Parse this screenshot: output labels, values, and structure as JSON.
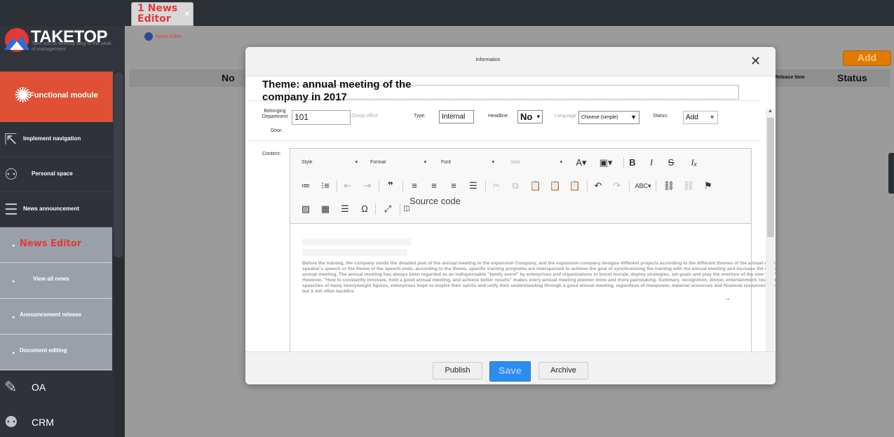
{
  "tab": {
    "title": "1 News Editor",
    "close": "×"
  },
  "logo": {
    "name": "TAKETOP",
    "tagline": "Take you to develop bing to the peak of management"
  },
  "sidebar": {
    "module": {
      "label": "Functional module"
    },
    "items": [
      {
        "label": "Implement navigation",
        "icon": "navigation-icon"
      },
      {
        "label": "Personal space",
        "icon": "person-icon"
      },
      {
        "label": "News announcement",
        "icon": "document-icon"
      }
    ],
    "subitems": [
      {
        "label": "News Editor",
        "active": true
      },
      {
        "label": "View all news"
      },
      {
        "label": "Announcement release"
      },
      {
        "label": "Document editing"
      }
    ],
    "bottom": [
      {
        "label": "OA",
        "icon": "edit-icon"
      },
      {
        "label": "CRM",
        "icon": "users-icon"
      }
    ]
  },
  "main": {
    "breadcrumb": "News Editor",
    "add_label": "Add",
    "columns": {
      "no": "No",
      "release_time": "Release time",
      "status": "Status"
    }
  },
  "modal": {
    "title": "Information",
    "close": "✕",
    "theme_label": "Theme: annual meeting of the company in 2017",
    "fields": {
      "dept_label": "Belonging Department",
      "dept_value": "101",
      "group_label": "Group office",
      "door_label": "Door:",
      "type_label": "Type:",
      "type_value": "Internal",
      "headline_label": "Headline:",
      "headline_value": "No",
      "language_label": "Language",
      "language_value": "Chinese (simple)",
      "status_label": "Status:",
      "status_value": "Add"
    },
    "content_label": "Content:",
    "toolbar": {
      "style": "Style",
      "format": "Format",
      "font": "Font",
      "size": "Size",
      "source": "Source code"
    },
    "content_text": "Before the training, the company sends the detailed plan of the annual meeting to the expansion Company, and the expansion company designs different projects according to the different themes of the annual meeting. After each speaker's speech or the theme of the speech ends, according to the theme, specific training programs are interspersed to achieve the goal of synchronizing the training with the annual meeting and increase the effect of the annual meeting. The annual meeting has always been regarded as an indispensable \"family event\" by enterprises and organizations to boost morale, deploy strategies, set goals and play the overture of the new year's work\". However, \"How to constantly innovate, hold a good annual meeting, and achieve better results\" makes every annual meeting planner more and more painstaking. Summary, recognition, dinner, entertainment, tourism, as well as speeches of many heavyweight figures, enterprises hope to inspire their spirits and unify their understanding through a good annual meeting, regardless of manpower, material resources and financial resources, lock the target, but it will often backfire",
    "footer": {
      "publish": "Publish",
      "save": "Save",
      "archive": "Archive"
    }
  }
}
